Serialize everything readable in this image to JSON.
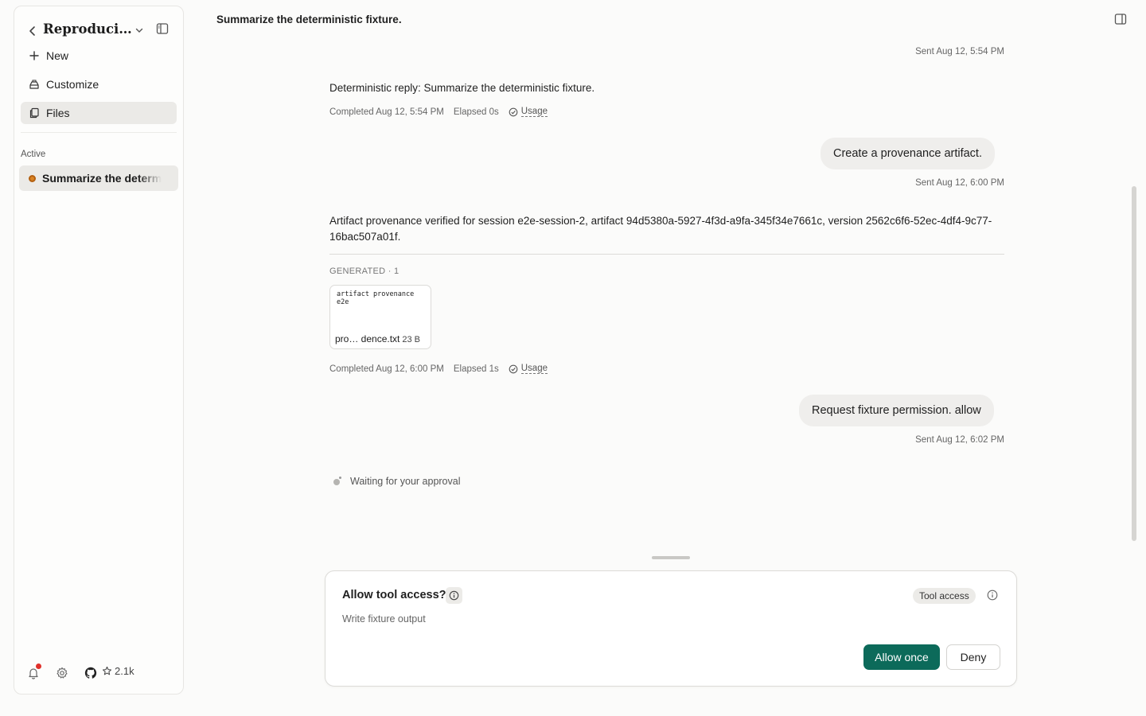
{
  "sidebar": {
    "title": "Reproducible Workspace",
    "nav": {
      "new": "New",
      "customize": "Customize",
      "files": "Files"
    },
    "section_label": "Active",
    "sessions": [
      {
        "label": "Summarize the deterministic fixture.",
        "status_color": "#d98324"
      }
    ],
    "footer": {
      "stars": "2.1k"
    }
  },
  "header": {
    "title": "Summarize the deterministic fixture."
  },
  "conversation": {
    "sent_1": "Sent Aug 12, 5:54 PM",
    "reply_1": "Deterministic reply: Summarize the deterministic fixture.",
    "completed_1": "Completed Aug 12, 5:54 PM",
    "elapsed_1": "Elapsed 0s",
    "usage_label": "Usage",
    "user_2": "Create a provenance artifact.",
    "sent_2": "Sent Aug 12, 6:00 PM",
    "reply_2": "Artifact provenance verified for session e2e-session-2, artifact 94d5380a-5927-4f3d-a9fa-345f34e7661c, version 2562c6f6-52ec-4df4-9c77-16bac507a01f.",
    "generated_label": "GENERATED · 1",
    "file": {
      "preview": "artifact provenance e2e",
      "name": "pro… dence.txt",
      "size": "23 B"
    },
    "completed_2": "Completed Aug 12, 6:00 PM",
    "elapsed_2": "Elapsed 1s",
    "user_3": "Request fixture permission. allow",
    "sent_3": "Sent Aug 12, 6:02 PM",
    "waiting": "Waiting for your approval"
  },
  "permission": {
    "title": "Allow tool access?",
    "description": "Write fixture output",
    "badge": "Tool access",
    "allow_label": "Allow once",
    "deny_label": "Deny",
    "accent": "#0c6a5a"
  }
}
